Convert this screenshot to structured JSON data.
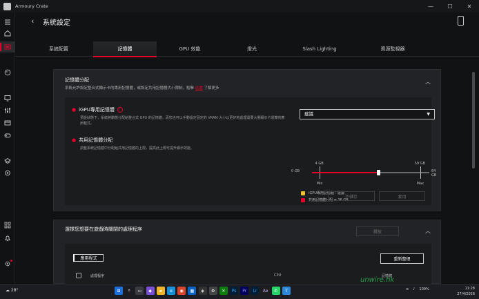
{
  "window": {
    "app_title": "Armoury Crate",
    "controls": [
      "minimize",
      "maximize",
      "close"
    ]
  },
  "header": {
    "title": "系統設定"
  },
  "tabs": [
    {
      "label": "系統配置",
      "active": false
    },
    {
      "label": "記憶體",
      "active": true
    },
    {
      "label": "GPU 效能",
      "active": false
    },
    {
      "label": "燈光",
      "active": false
    },
    {
      "label": "Slash Lighting",
      "active": false
    },
    {
      "label": "資源監視器",
      "active": false
    }
  ],
  "memory_panel": {
    "title": "記憶體分配",
    "subtitle_before": "系統允許設定整合式顯示卡的專用記憶體，或設定共用記憶體大小限制，點擊",
    "subtitle_link": "此處",
    "subtitle_after": "了解更多",
    "igpu": {
      "title": "iGPU專用記憶體",
      "desc": "預設狀態下，系統將動態分配給整合式 GPU 的記憶體，而您也可以手動設定固定的 VRAM 大小以更好地處理需要大量顯示卡運算的應用程式。",
      "select_value": "建議"
    },
    "shared": {
      "title": "共用記憶體分配",
      "desc": "調整系統記憶體中分配給共用記憶體的上限，提高此上限可提升顯示效能。",
      "slider": {
        "min_label": "0 GB",
        "max_label": "64 GB",
        "mark_min_value": "4 GB",
        "mark_max_value": "59 GB",
        "mark_min_text": "Min",
        "mark_max_text": "Max",
        "min_gb": 0,
        "max_gb": 64,
        "mark_min_gb": 4,
        "mark_max_gb": 59,
        "value_gb": 36
      }
    },
    "legend": [
      {
        "label": "iGPU專用記憶體：建議",
        "color": "#f2c12e"
      },
      {
        "label": "共用記憶體分配 = 36 GB",
        "color": "#e4002b"
      }
    ],
    "buttons": {
      "cancel": "不儲存",
      "apply": "套用"
    }
  },
  "process_panel": {
    "title": "選擇您想要在遊戲時關閉的處理程序",
    "release_button": "釋放",
    "filter_chip": "應用程式",
    "refresh_button": "重新整理",
    "columns": [
      "處理程序",
      "CPU",
      "記憶體"
    ]
  },
  "taskbar": {
    "weather": "28°",
    "battery": "100%",
    "time": "11:28",
    "date": "27/4/2026"
  },
  "watermark": "unwire.hk"
}
